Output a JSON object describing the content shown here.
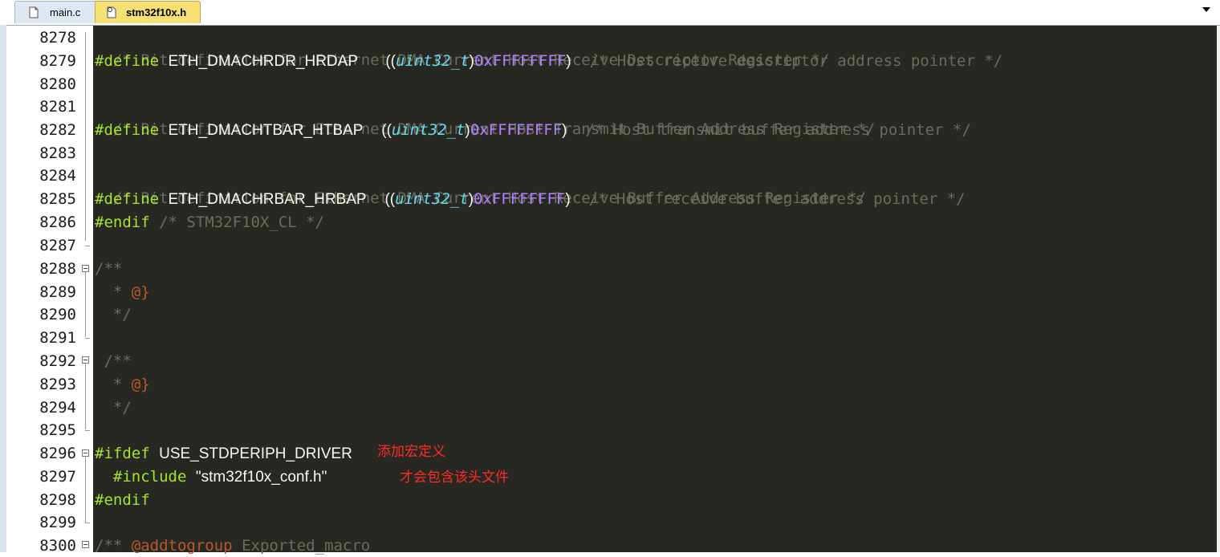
{
  "tabs": [
    {
      "label": "main.c",
      "active": false
    },
    {
      "label": "stm32f10x.h",
      "active": true
    }
  ],
  "line_numbers": [
    "8278",
    "8279",
    "8280",
    "8281",
    "8282",
    "8283",
    "8284",
    "8285",
    "8286",
    "8287",
    "8288",
    "8289",
    "8290",
    "8291",
    "8292",
    "8293",
    "8294",
    "8295",
    "8296",
    "8297",
    "8298",
    "8299",
    "8300"
  ],
  "code": {
    "l8278": "/* Bit definition for Ethernet DMA Current Host Receive Descriptor Register */",
    "l8279": {
      "pp": "#define",
      "macro": "ETH_DMACHRDR_HRDAP",
      "open": "((",
      "type": "uint32_t",
      "close": ")",
      "value": "0xFFFFFFFF",
      "paren": ")",
      "comment": "/* Host receive descriptor address pointer */"
    },
    "l8281": "/* Bit definition for Ethernet DMA Current Host Transmit Buffer Address Register */",
    "l8282": {
      "pp": "#define",
      "macro": "ETH_DMACHTBAR_HTBAP",
      "open": "((",
      "type": "uint32_t",
      "close": ")",
      "value": "0xFFFFFFFF",
      "paren": ")",
      "comment": "/* Host transmit buffer address pointer */"
    },
    "l8284": "/* Bit definition for Ethernet DMA Current Host Receive Buffer Address Register */",
    "l8285": {
      "pp": "#define",
      "macro": "ETH_DMACHRBAR_HRBAP",
      "open": "((",
      "type": "uint32_t",
      "close": ")",
      "value": "0xFFFFFFFF",
      "paren": ")",
      "comment": "/* Host receive buffer address pointer */"
    },
    "l8286": {
      "pp": "#endif",
      "comment": "/* STM32F10X_CL */"
    },
    "l8288": "/**",
    "l8289_star": "*",
    "l8289_tag": "@}",
    "l8290": "*/",
    "l8292": "/**",
    "l8293_star": "*",
    "l8293_tag": "@}",
    "l8294": "*/",
    "l8296": {
      "pp": "#ifdef",
      "macro": "USE_STDPERIPH_DRIVER"
    },
    "l8297": {
      "pp": "#include",
      "file": "\"stm32f10x_conf.h\""
    },
    "l8298": "#endif",
    "l8300": {
      "open": "/**",
      "tag": "@addtogroup",
      "rest": "Exported_macro"
    }
  },
  "annotations": {
    "macro_note": "添加宏定义",
    "include_note": "才会包含该头文件"
  },
  "colors": {
    "editor_bg": "#272822",
    "comment": "#6b6b5e",
    "preprocessor": "#a6e22e",
    "type": "#66d9ef",
    "number": "#ae81ff",
    "annotation": "#ff2a2a",
    "active_tab": "#f6df73"
  }
}
